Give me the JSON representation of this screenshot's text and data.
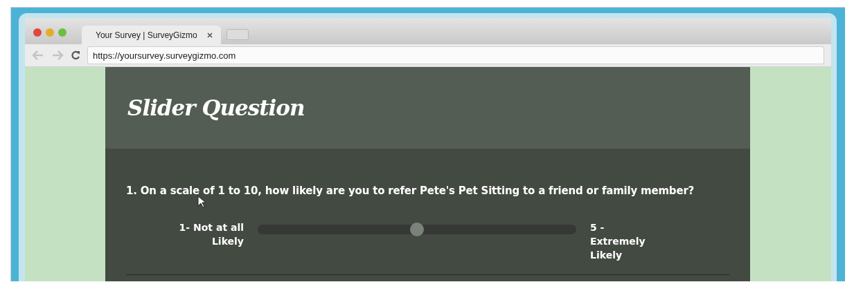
{
  "browser": {
    "tab_title": "Your Survey | SurveyGizmo",
    "address": "https://yoursurvey.surveygizmo.com"
  },
  "survey": {
    "title": "Slider Question",
    "question": "1. On a scale of 1 to 10, how likely are you to refer Pete's Pet Sitting to a friend or family member?",
    "slider": {
      "min_label": "1- Not at all Likely",
      "max_label": "5 - Extremely Likely",
      "level": 0.5
    }
  }
}
